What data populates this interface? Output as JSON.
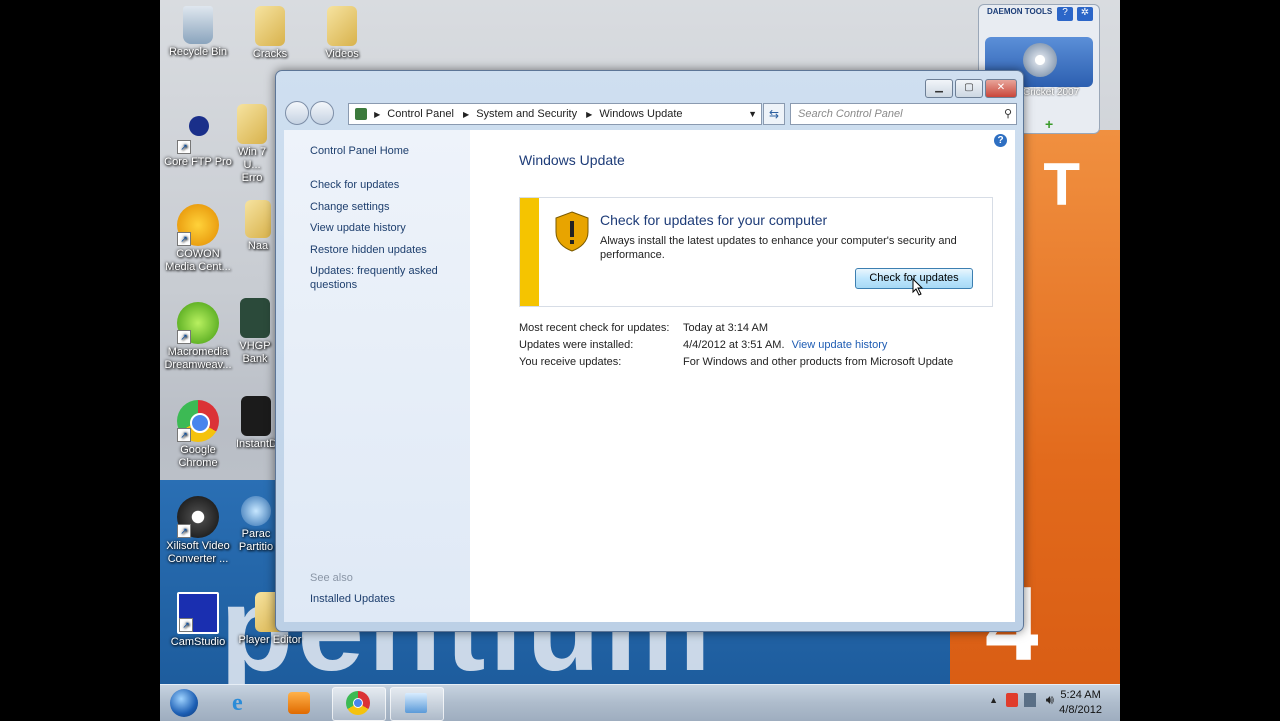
{
  "desktop": {
    "icons": [
      {
        "label": "Recycle Bin"
      },
      {
        "label": "Cracks"
      },
      {
        "label": "Videos"
      },
      {
        "label": "Core FTP Pro"
      },
      {
        "label": "Win 7 U... Erro"
      },
      {
        "label": "COWON Media Cent..."
      },
      {
        "label": "Naa"
      },
      {
        "label": "Macromedia Dreamweav..."
      },
      {
        "label": "VHGP Bank"
      },
      {
        "label": "Google Chrome"
      },
      {
        "label": "InstantD"
      },
      {
        "label": "Xilisoft Video Converter ..."
      },
      {
        "label": "Parac Partitio"
      },
      {
        "label": "CamStudio"
      },
      {
        "label": "Player Editor"
      }
    ],
    "wallpaper": {
      "big_word": "pentium",
      "big_number": "4",
      "letter": "T"
    }
  },
  "daemon_tools": {
    "brand": "DAEMON TOOLS",
    "item": "Cricket 2007"
  },
  "window": {
    "breadcrumb": [
      "Control Panel",
      "System and Security",
      "Windows Update"
    ],
    "search_placeholder": "Search Control Panel",
    "left_pane": {
      "home": "Control Panel Home",
      "links": [
        "Check for updates",
        "Change settings",
        "View update history",
        "Restore hidden updates",
        "Updates: frequently asked questions"
      ],
      "see_also_heading": "See also",
      "see_also_links": [
        "Installed Updates"
      ]
    },
    "main": {
      "title": "Windows Update",
      "panel_heading": "Check for updates for your computer",
      "panel_text": "Always install the latest updates to enhance your computer's security and performance.",
      "button": "Check for updates",
      "info": [
        {
          "key": "Most recent check for updates:",
          "value": "Today at 3:14 AM",
          "link": ""
        },
        {
          "key": "Updates were installed:",
          "value": "4/4/2012 at 3:51 AM.",
          "link": "View update history"
        },
        {
          "key": "You receive updates:",
          "value": "For Windows and other products from Microsoft Update",
          "link": ""
        }
      ]
    }
  },
  "taskbar": {
    "time": "5:24 AM",
    "date": "4/8/2012"
  },
  "colors": {
    "accent": "#1e3c78",
    "warning_bar": "#f5c400",
    "link": "#1e5cb3"
  }
}
